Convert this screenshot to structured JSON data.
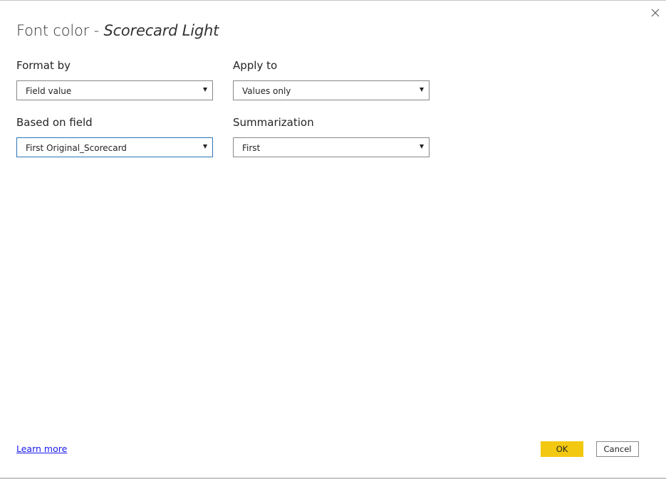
{
  "dialog": {
    "title": "Font color - ",
    "subtitle": "Scorecard Light",
    "close_icon": "close-icon"
  },
  "fields": {
    "format_by": {
      "label": "Format by",
      "value": "Field value"
    },
    "apply_to": {
      "label": "Apply to",
      "value": "Values only"
    },
    "based_on_field": {
      "label": "Based on field",
      "value": "First Original_Scorecard"
    },
    "summarization": {
      "label": "Summarization",
      "value": "First"
    }
  },
  "footer": {
    "learn_more": "Learn more",
    "ok_label": "OK",
    "cancel_label": "Cancel"
  },
  "colors": {
    "accent_ok": "#f2c811",
    "focus_border": "#2e75b6",
    "link": "#1a1aee"
  }
}
